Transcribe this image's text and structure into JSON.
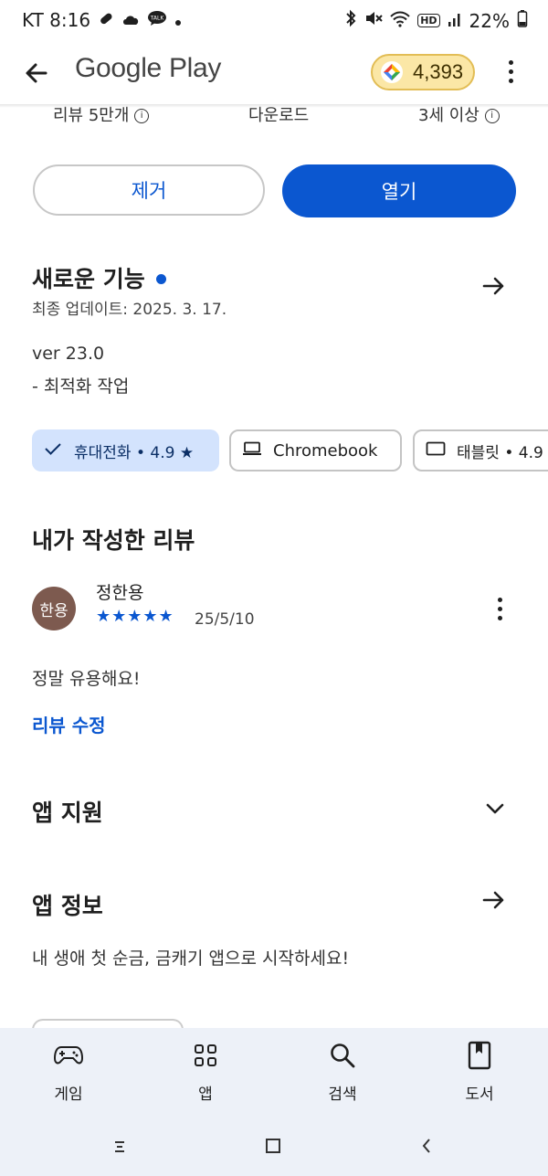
{
  "status_bar": {
    "carrier_time": "KT 8:16",
    "battery": "22%",
    "hd_badge": "HD",
    "icons_left": [
      "pill-icon",
      "cloud-icon",
      "talk-icon",
      "dot-icon"
    ],
    "icons_right": [
      "bluetooth-icon",
      "mute-icon",
      "wifi-icon",
      "hd-icon",
      "signal-icon",
      "battery-icon"
    ]
  },
  "header": {
    "title": "Google Play",
    "points": "4,393"
  },
  "info_row": {
    "reviews": "리뷰 5만개",
    "downloads": "다운로드",
    "age": "3세 이상"
  },
  "actions": {
    "remove_label": "제거",
    "open_label": "열기"
  },
  "whats_new": {
    "title": "새로운 기능",
    "last_updated": "최종 업데이트: 2025. 3. 17.",
    "version": "ver 23.0",
    "note": "- 최적화 작업"
  },
  "device_chips": [
    {
      "label": "휴대전화 • 4.9 ★",
      "selected": true
    },
    {
      "label": "Chromebook",
      "selected": false
    },
    {
      "label": "태블릿 • 4.9",
      "selected": false
    }
  ],
  "my_review": {
    "title": "내가 작성한 리뷰",
    "avatar_initials": "한용",
    "author": "정한용",
    "rating": 5,
    "stars": "★★★★★",
    "date": "25/5/10",
    "text": "정말 유용해요!",
    "edit_label": "리뷰 수정"
  },
  "app_support": {
    "title": "앱 지원"
  },
  "app_info": {
    "title": "앱 정보",
    "description": "내 생애 첫 순금, 금캐기 앱으로 시작하세요!"
  },
  "bottom_nav": [
    {
      "label": "게임",
      "icon": "gamepad-icon"
    },
    {
      "label": "앱",
      "icon": "apps-grid-icon"
    },
    {
      "label": "검색",
      "icon": "search-icon"
    },
    {
      "label": "도서",
      "icon": "book-icon"
    }
  ],
  "colors": {
    "accent": "#0b57d0",
    "chip_selected_bg": "#d3e3fd",
    "points_bg": "#fbe7a6",
    "avatar_bg": "#7d5a4f",
    "bottom_nav_bg": "#edf1f8"
  }
}
